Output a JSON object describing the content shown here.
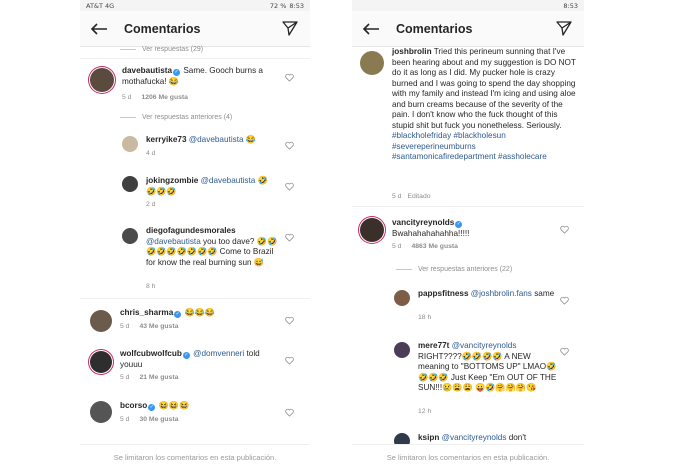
{
  "left": {
    "status": {
      "carrier": "AT&T 4G",
      "battery": "72 %",
      "time": "8:53"
    },
    "header_title": "Comentarios",
    "view_replies_top": "Ver respuestas (29)",
    "comments": [
      {
        "user": "davebautista",
        "text": "Same. Gooch burns a mothafucka! 😂",
        "age": "5 d",
        "likes": "1206 Me gusta"
      },
      {
        "user": "chris_sharma",
        "text": "😂😂😂",
        "age": "5 d",
        "likes": "43 Me gusta"
      },
      {
        "user": "wolfcubwolfcub",
        "tag": "@domvenneri",
        "text": "told youuu",
        "age": "5 d",
        "likes": "21 Me gusta"
      },
      {
        "user": "bcorso",
        "text": "😆😆😆",
        "age": "5 d",
        "likes": "30 Me gusta"
      }
    ],
    "view_previous": "Ver respuestas anteriores (4)",
    "replies": [
      {
        "user": "kerryike73",
        "tag": "@davebautista",
        "text": "😂",
        "age": "4 d"
      },
      {
        "user": "jokingzombie",
        "tag": "@davebautista",
        "text": "🤣 🤣🤣🤣",
        "age": "2 d"
      },
      {
        "user": "diegofagundesmorales",
        "tag": "@davebautista",
        "text": "you too dave? 🤣🤣🤣🤣🤣🤣🤣🤣🤣 Come to Brazil for know the real burning sun 😅",
        "age": "8 h"
      }
    ],
    "footer": "Se limitaron los comentarios en esta publicación."
  },
  "right": {
    "status": {
      "time": "8:53"
    },
    "header_title": "Comentarios",
    "main": {
      "user": "joshbrolin",
      "text": "Tried this perineum sunning that I've been hearing about and my suggestion is DO NOT do it as long as I did. My pucker hole is crazy burned and I was going to spend the day shopping with my family and instead I'm icing and using aloe and burn creams because of the severity of the pain. I don't know who the fuck thought of this stupid shit but fuck you nonetheless. Seriously.",
      "hashtags": "#blackholefriday #blackholesun #severeperineumburns #santamonicafiredepartment #assholecare",
      "age": "5 d",
      "edited": "Editado"
    },
    "comment": {
      "user": "vancityreynolds",
      "text": "Bwahahahahahha!!!!!",
      "age": "5 d",
      "likes": "4863 Me gusta"
    },
    "view_previous": "Ver respuestas anteriores (22)",
    "replies": [
      {
        "user": "pappsfitness",
        "tag": "@joshbrolin.fans",
        "text": "same",
        "age": "18 h"
      },
      {
        "user": "mere77t",
        "tag": "@vancityreynolds",
        "text": "RIGHT????🤣🤣🤣🤣 A NEW meaning to \"BOTTOMS UP\" LMAO🤣🤣🤣🤣 Just Keep \"Em OUT OF THE SUN!!!😢😩😩 😛🤣🤗🤗🤗😘",
        "age": "12 h"
      },
      {
        "user": "ksipn",
        "tag": "@vancityreynolds",
        "text": "don't"
      }
    ],
    "footer": "Se limitaron los comentarios en esta publicación."
  }
}
